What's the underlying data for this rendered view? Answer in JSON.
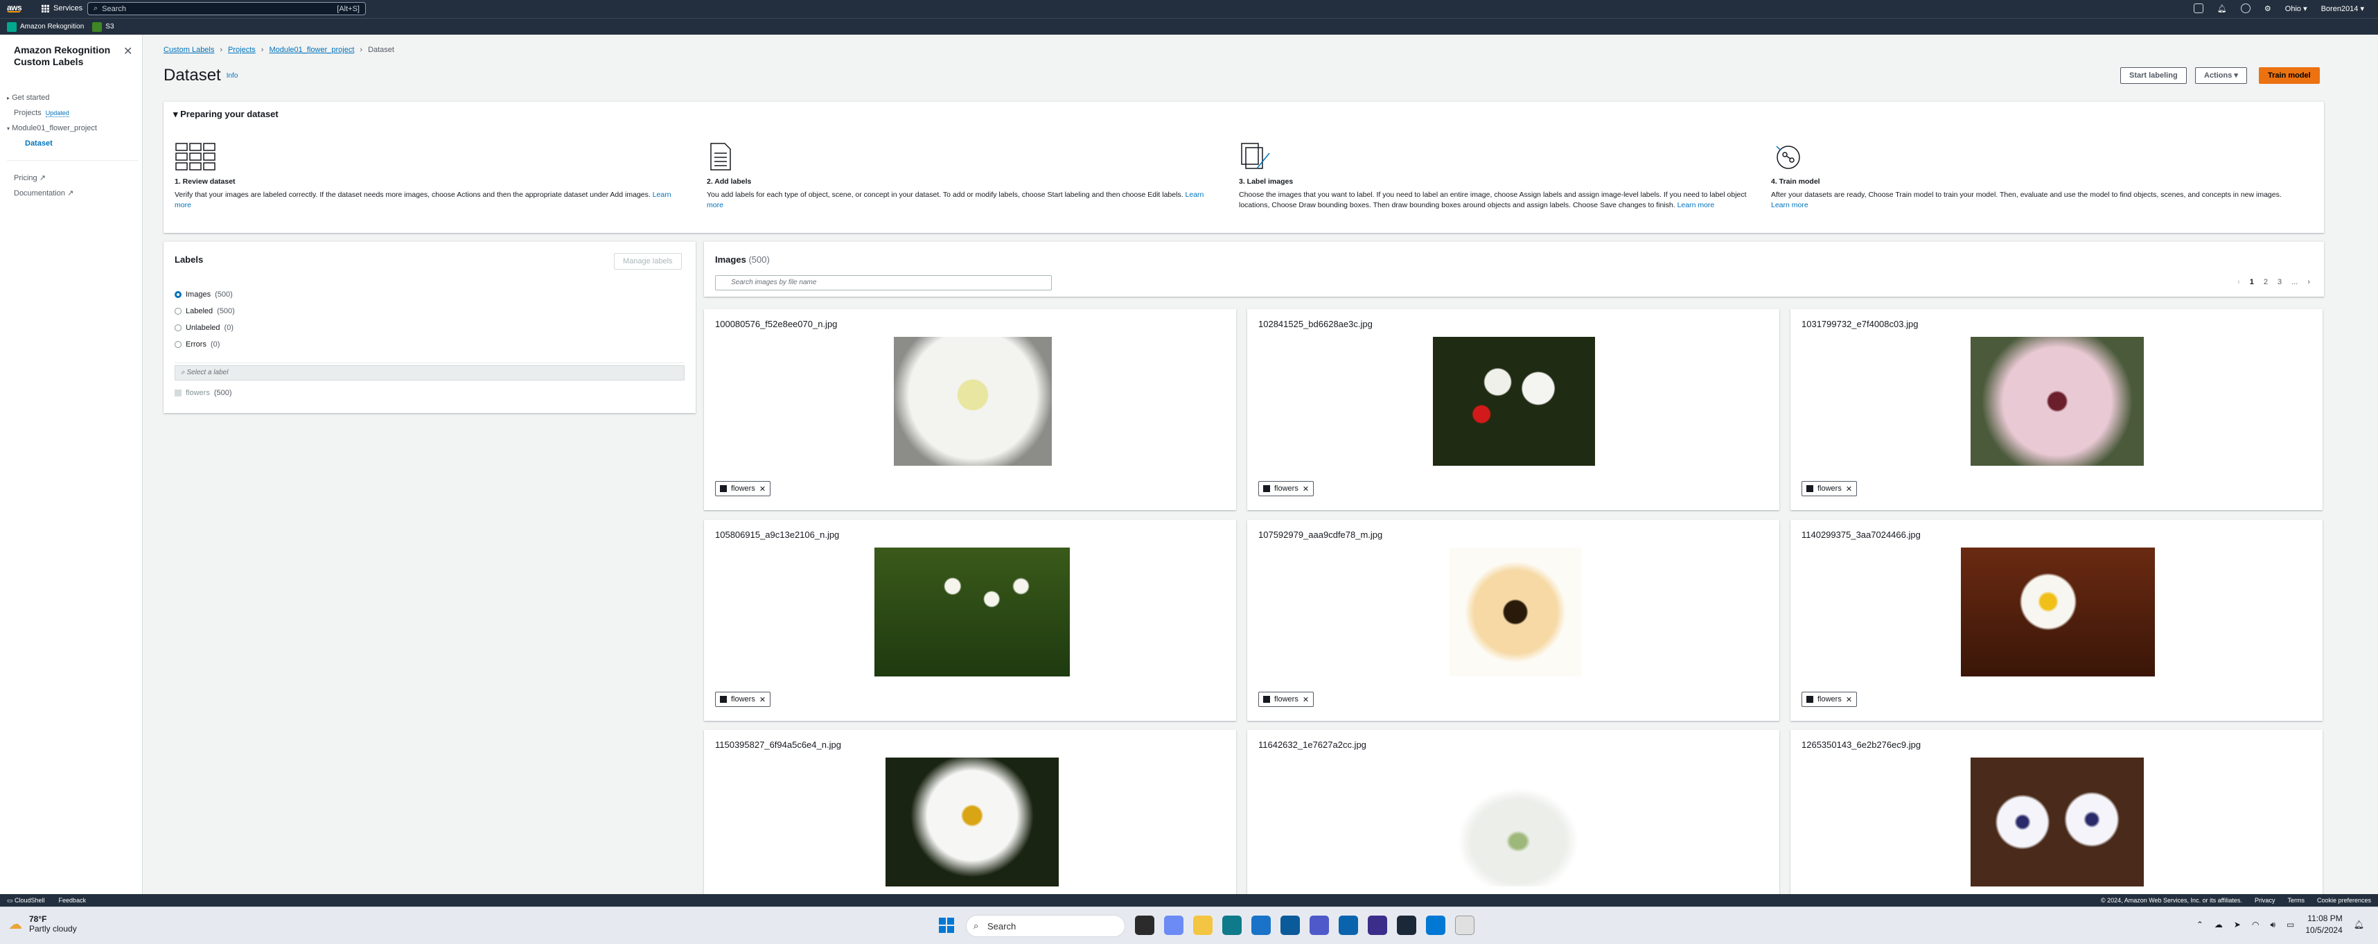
{
  "topnav": {
    "logo": "aws",
    "services": "Services",
    "search_placeholder": "Search",
    "search_kbd": "[Alt+S]",
    "region": "Ohio",
    "account": "Boren2014"
  },
  "favorites": [
    {
      "label": "Amazon Rekognition"
    },
    {
      "label": "S3"
    }
  ],
  "sidebar": {
    "title": "Amazon Rekognition Custom Labels",
    "items": {
      "get_started": "Get started",
      "projects": "Projects",
      "updated": "Updated",
      "project": "Module01_flower_project",
      "dataset": "Dataset",
      "pricing": "Pricing",
      "documentation": "Documentation"
    }
  },
  "breadcrumbs": [
    "Custom Labels",
    "Projects",
    "Module01_flower_project",
    "Dataset"
  ],
  "page": {
    "title": "Dataset",
    "info": "Info"
  },
  "actions": {
    "start_labeling": "Start labeling",
    "actions": "Actions",
    "train_model": "Train model"
  },
  "prep": {
    "title": "Preparing your dataset",
    "steps": [
      {
        "title": "1. Review dataset",
        "text": "Verify that your images are labeled correctly. If the dataset needs more images, choose Actions and then the appropriate dataset under Add images.",
        "link": "Learn more"
      },
      {
        "title": "2. Add labels",
        "text": "You add labels for each type of object, scene, or concept in your dataset. To add or modify labels, choose Start labeling and then choose Edit labels.",
        "link": "Learn more"
      },
      {
        "title": "3. Label images",
        "text": "Choose the images that you want to label. If you need to label an entire image, choose Assign labels and assign image-level labels. If you need to label object locations, Choose Draw bounding boxes. Then draw bounding boxes around objects and assign labels. Choose Save changes to finish.",
        "link": "Learn more"
      },
      {
        "title": "4. Train model",
        "text": "After your datasets are ready, Choose Train model to train your model. Then, evaluate and use the model to find objects, scenes, and concepts in new images.",
        "link": "Learn more"
      }
    ]
  },
  "labels": {
    "title": "Labels",
    "manage": "Manage labels",
    "filters": [
      {
        "label": "Images",
        "count": "(500)"
      },
      {
        "label": "Labeled",
        "count": "(500)"
      },
      {
        "label": "Unlabeled",
        "count": "(0)"
      },
      {
        "label": "Errors",
        "count": "(0)"
      }
    ],
    "select_placeholder": "Select a label",
    "label_item": {
      "name": "flowers",
      "count": "(500)"
    }
  },
  "images": {
    "title": "Images",
    "count": "(500)",
    "search_placeholder": "Search images by file name",
    "pages": [
      "1",
      "2",
      "3",
      "..."
    ],
    "items": [
      {
        "file": "100080576_f52e8ee070_n.jpg",
        "tag": "flowers"
      },
      {
        "file": "102841525_bd6628ae3c.jpg",
        "tag": "flowers"
      },
      {
        "file": "1031799732_e7f4008c03.jpg",
        "tag": "flowers"
      },
      {
        "file": "105806915_a9c13e2106_n.jpg",
        "tag": "flowers"
      },
      {
        "file": "107592979_aaa9cdfe78_m.jpg",
        "tag": "flowers"
      },
      {
        "file": "1140299375_3aa7024466.jpg",
        "tag": "flowers"
      },
      {
        "file": "1150395827_6f94a5c6e4_n.jpg",
        "tag": ""
      },
      {
        "file": "11642632_1e7627a2cc.jpg",
        "tag": ""
      },
      {
        "file": "1265350143_6e2b276ec9.jpg",
        "tag": ""
      }
    ]
  },
  "footer": {
    "cloudshell": "CloudShell",
    "feedback": "Feedback",
    "copyright": "© 2024, Amazon Web Services, Inc. or its affiliates.",
    "privacy": "Privacy",
    "terms": "Terms",
    "cookie": "Cookie preferences"
  },
  "taskbar": {
    "temp": "78°F",
    "weather": "Partly cloudy",
    "search": "Search",
    "time": "11:08 PM",
    "date": "10/5/2024"
  }
}
